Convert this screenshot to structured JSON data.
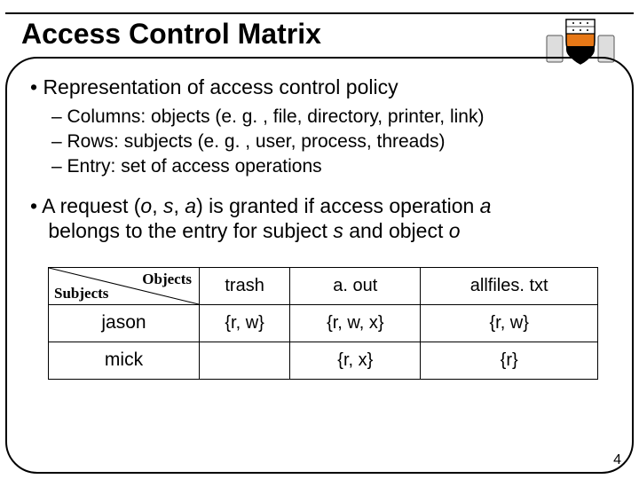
{
  "title": "Access Control Matrix",
  "bullets": {
    "b1": "• Representation of access control policy",
    "s1": "– Columns: objects (e. g. , file, directory, printer, link)",
    "s2": "– Rows: subjects (e. g. , user, process, threads)",
    "s3": "– Entry: set of access operations",
    "b2_pre": "• A request (",
    "b2_o1": "o",
    "b2_c1": ", ",
    "b2_s1": "s",
    "b2_c2": ", ",
    "b2_a1": "a",
    "b2_mid1": ") is granted if access operation ",
    "b2_a2": "a",
    "b2_mid2": " belongs to the entry for subject ",
    "b2_s2": "s",
    "b2_mid3": " and object ",
    "b2_o2": "o"
  },
  "table": {
    "corner_obj": "Objects",
    "corner_sub": "Subjects",
    "cols": {
      "c1": "trash",
      "c2": "a. out",
      "c3": "allfiles. txt"
    },
    "rows": {
      "r1": {
        "name": "jason",
        "c1": "{r, w}",
        "c2": "{r, w, x}",
        "c3": "{r, w}"
      },
      "r2": {
        "name": "mick",
        "c1": "",
        "c2": "{r, x}",
        "c3": "{r}"
      }
    }
  },
  "pagenum": "4",
  "chart_data": {
    "type": "table",
    "title": "Access Control Matrix",
    "col_headers": [
      "trash",
      "a. out",
      "allfiles. txt"
    ],
    "row_headers": [
      "jason",
      "mick"
    ],
    "cells": [
      [
        "{r, w}",
        "{r, w, x}",
        "{r, w}"
      ],
      [
        "",
        "{r, x}",
        "{r}"
      ]
    ]
  }
}
